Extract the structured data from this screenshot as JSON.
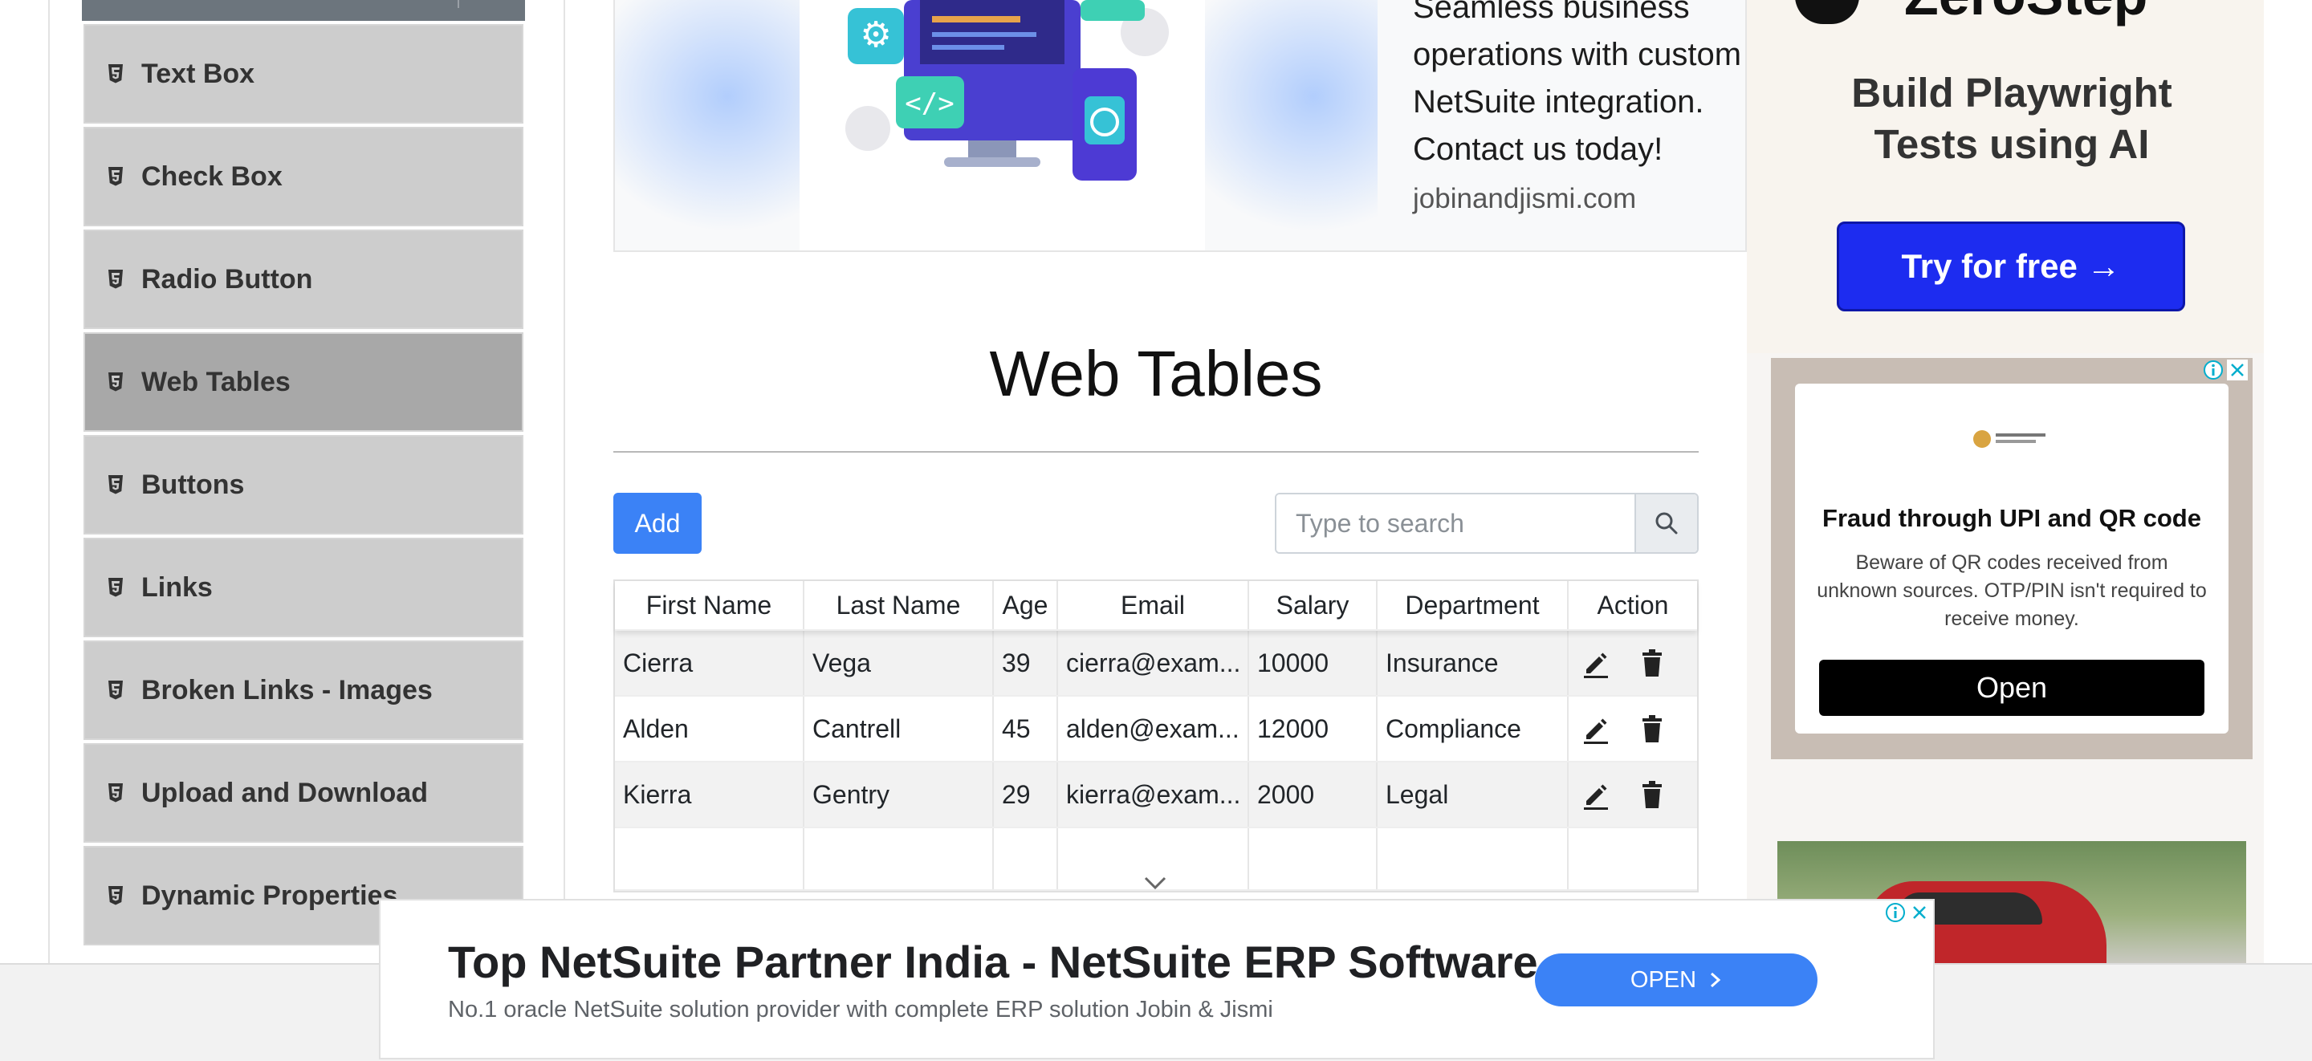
{
  "sidebar": {
    "items": [
      {
        "label": "Text Box",
        "active": false
      },
      {
        "label": "Check Box",
        "active": false
      },
      {
        "label": "Radio Button",
        "active": false
      },
      {
        "label": "Web Tables",
        "active": true
      },
      {
        "label": "Buttons",
        "active": false
      },
      {
        "label": "Links",
        "active": false
      },
      {
        "label": "Broken Links - Images",
        "active": false
      },
      {
        "label": "Upload and Download",
        "active": false
      },
      {
        "label": "Dynamic Properties",
        "active": false
      }
    ]
  },
  "top_ad": {
    "lines": [
      "Seamless business",
      "operations with custom",
      "NetSuite integration.",
      "Contact us today!"
    ],
    "url": "jobinandjismi.com"
  },
  "main": {
    "title": "Web Tables",
    "add_label": "Add",
    "search_placeholder": "Type to search"
  },
  "table": {
    "headers": [
      "First Name",
      "Last Name",
      "Age",
      "Email",
      "Salary",
      "Department",
      "Action"
    ],
    "rows": [
      [
        "Cierra",
        "Vega",
        "39",
        "cierra@exam...",
        "10000",
        "Insurance"
      ],
      [
        "Alden",
        "Cantrell",
        "45",
        "alden@exam...",
        "12000",
        "Compliance"
      ],
      [
        "Kierra",
        "Gentry",
        "29",
        "kierra@exam...",
        "2000",
        "Legal"
      ]
    ]
  },
  "right_ads": {
    "zerostep_logo": "ZeroStep",
    "zerostep_headline_1": "Build Playwright",
    "zerostep_headline_2": "Tests using AI",
    "zerostep_cta": "Try for free →",
    "fraud_title": "Fraud through UPI and QR code",
    "fraud_body": "Beware of QR codes received from unknown sources. OTP/PIN isn't required to receive money.",
    "fraud_cta": "Open"
  },
  "bottom_ad": {
    "headline": "Top NetSuite Partner India - NetSuite ERP Software",
    "sub": "No.1 oracle NetSuite solution provider with complete ERP solution Jobin & Jismi",
    "cta": "OPEN"
  },
  "colors": {
    "accent": "#3b82f6",
    "sidebar_bg": "#cdcdcd",
    "sidebar_active": "#a8a8a8",
    "zerostep_button": "#1d2cf0"
  }
}
